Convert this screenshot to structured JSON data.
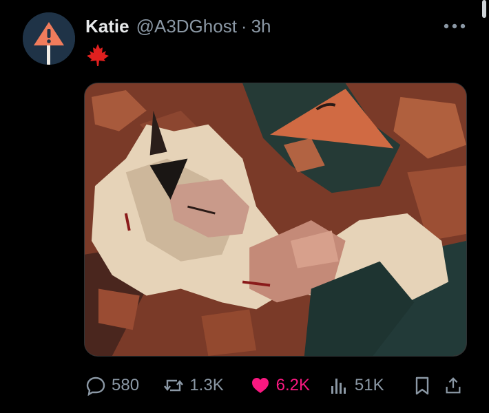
{
  "post": {
    "author_name": "Katie",
    "author_handle": "@A3DGhost",
    "separator": "·",
    "timestamp": "3h",
    "body_emoji": "maple-leaf-icon"
  },
  "icons": {
    "avatar": "warning-sign-avatar",
    "more": "more-dots-icon",
    "reply": "reply-icon",
    "repost": "repost-icon",
    "like": "heart-icon",
    "views": "views-icon",
    "bookmark": "bookmark-icon",
    "share": "share-icon"
  },
  "stats": {
    "replies": "580",
    "reposts": "1.3K",
    "likes": "6.2K",
    "views": "51K"
  },
  "colors": {
    "background": "#000000",
    "text_primary": "#e7e9ea",
    "text_secondary": "#8b98a5",
    "like_active": "#f91880",
    "avatar_bg": "#1f3347",
    "maple_leaf": "#e0201f"
  }
}
